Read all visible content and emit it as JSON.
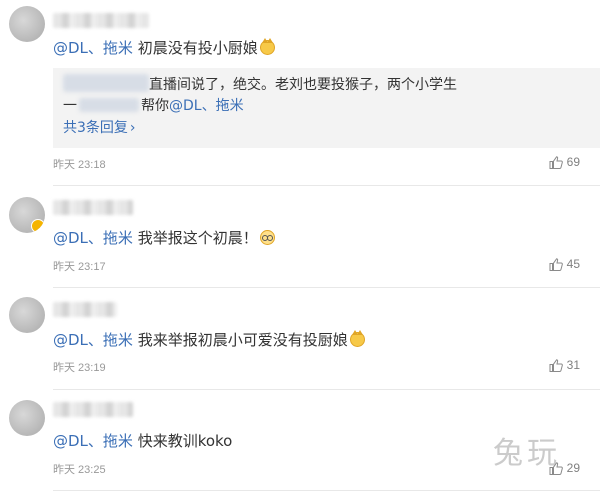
{
  "comments": [
    {
      "mention": "@DL、拖米",
      "text": "初晨没有投小厨娘",
      "emoji": "cat-face-icon",
      "reply": {
        "line1": "直播间说了，绝交。老刘也要投猴子，两个小学生",
        "line2_prefix": "一",
        "line2_text": "帮你",
        "line2_mention": "@DL、拖米",
        "more_label": "共3条回复",
        "more_chevron": "›"
      },
      "time": "昨天 23:18",
      "likes": "69"
    },
    {
      "mention": "@DL、拖米",
      "text": "我举报这个初晨！",
      "emoji": "glasses-face-icon",
      "time": "昨天 23:17",
      "likes": "45"
    },
    {
      "mention": "@DL、拖米",
      "text": "我来举报初晨小可爱没有投厨娘",
      "emoji": "cat-face-icon",
      "time": "昨天 23:19",
      "likes": "31"
    },
    {
      "mention": "@DL、拖米",
      "text": "快来教训koko",
      "time": "昨天 23:25",
      "likes": "29"
    }
  ],
  "watermark": "兔玩",
  "colors": {
    "link": "#3b6fb6",
    "meta": "#999999",
    "reply_bg": "#f3f3f3"
  }
}
